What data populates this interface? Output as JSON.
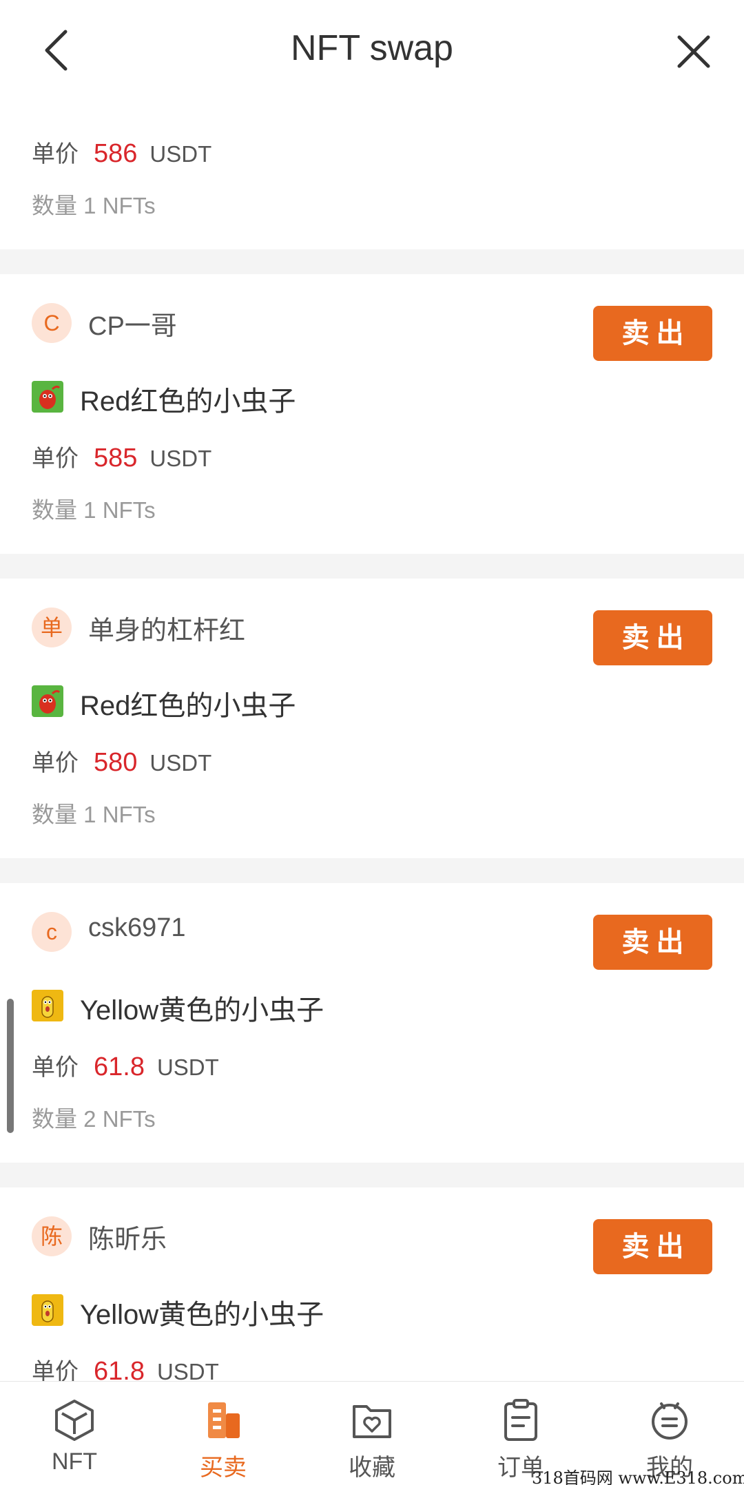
{
  "header": {
    "title": "NFT swap"
  },
  "top_partial": {
    "price_label": "单价",
    "price": "586",
    "unit": "USDT",
    "quantity": "数量 1 NFTs"
  },
  "listings": [
    {
      "avatar": "C",
      "seller": "CP一哥",
      "action": "卖出",
      "item_icon": "red-bug-icon",
      "item": "Red红色的小虫子",
      "price_label": "单价",
      "price": "585",
      "unit": "USDT",
      "quantity": "数量 1 NFTs"
    },
    {
      "avatar": "单",
      "seller": "单身的杠杆红",
      "action": "卖出",
      "item_icon": "red-bug-icon",
      "item": "Red红色的小虫子",
      "price_label": "单价",
      "price": "580",
      "unit": "USDT",
      "quantity": "数量 1 NFTs"
    },
    {
      "avatar": "c",
      "seller": "csk6971",
      "action": "卖出",
      "item_icon": "yellow-bug-icon",
      "item": "Yellow黄色的小虫子",
      "price_label": "单价",
      "price": "61.8",
      "unit": "USDT",
      "quantity": "数量 2 NFTs"
    },
    {
      "avatar": "陈",
      "seller": "陈昕乐",
      "action": "卖出",
      "item_icon": "yellow-bug-icon",
      "item": "Yellow黄色的小虫子",
      "price_label": "单价",
      "price": "61.8",
      "unit": "USDT"
    }
  ],
  "tabs": [
    {
      "label": "NFT",
      "icon": "cube-icon",
      "active": false
    },
    {
      "label": "买卖",
      "icon": "trade-icon",
      "active": true
    },
    {
      "label": "收藏",
      "icon": "favorites-folder-icon",
      "active": false
    },
    {
      "label": "订单",
      "icon": "clipboard-icon",
      "active": false
    },
    {
      "label": "我的",
      "icon": "profile-icon",
      "active": false
    }
  ],
  "watermark": "318首码网 www.E318.com",
  "colors": {
    "accent": "#e8691f",
    "price": "#d9262b",
    "avatar_bg": "#fde3d6",
    "page_bg": "#f4f4f4"
  }
}
